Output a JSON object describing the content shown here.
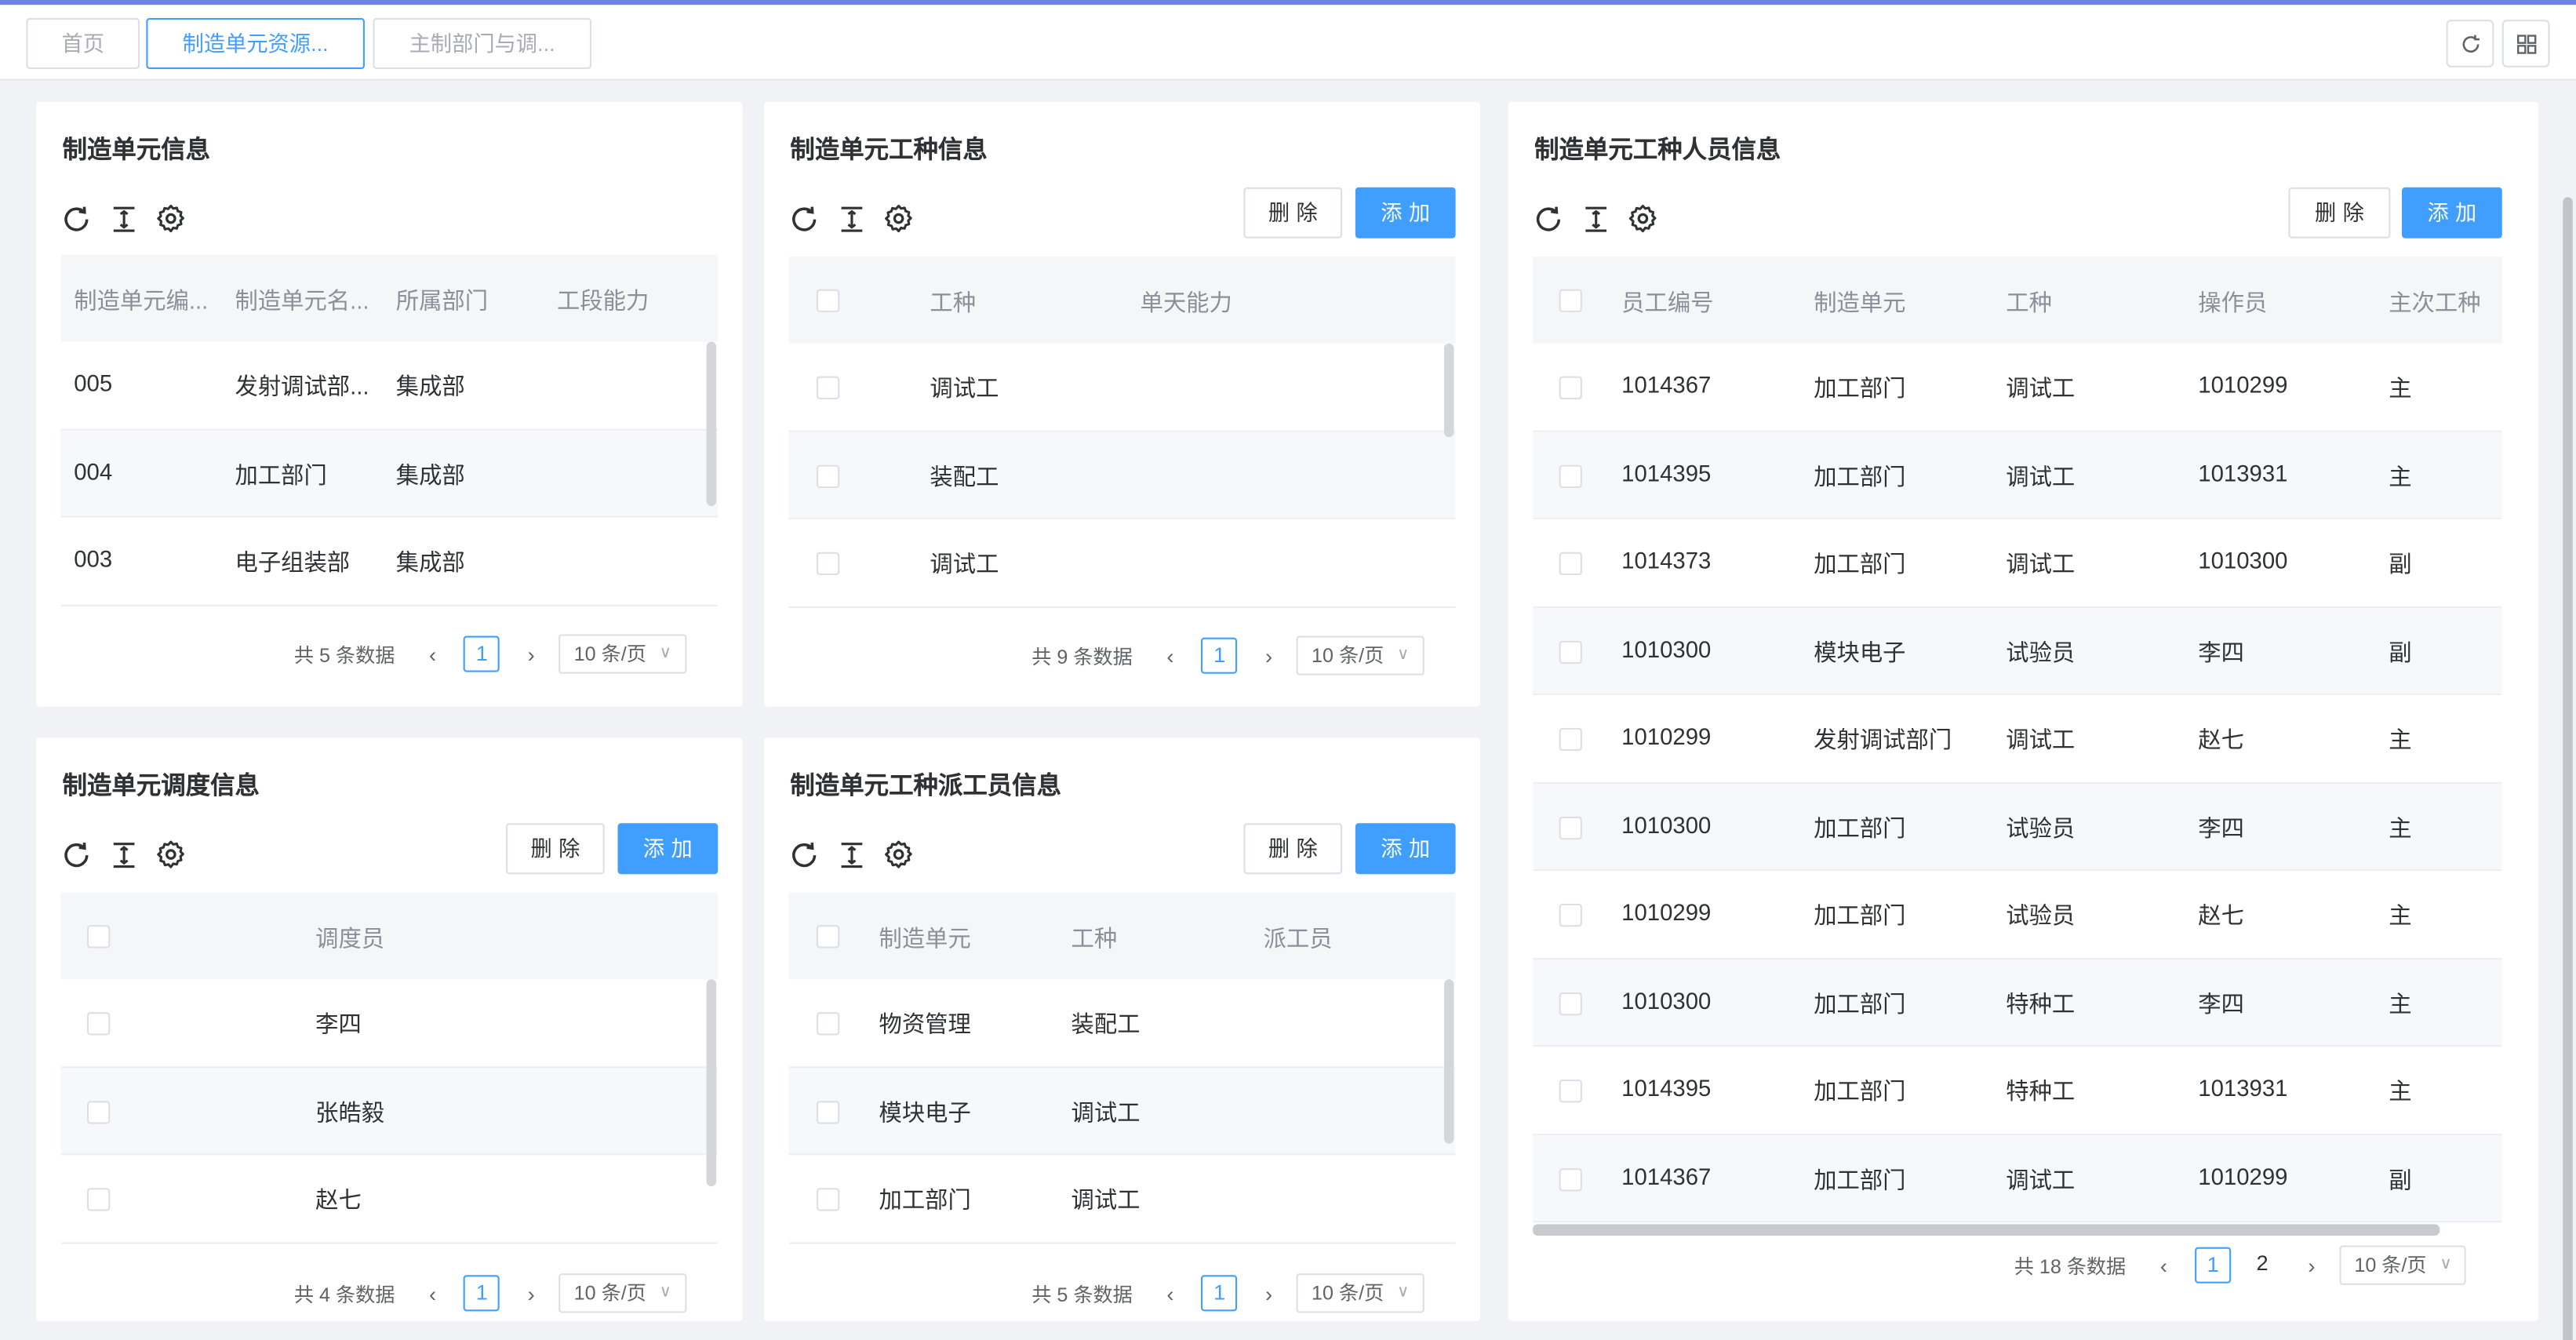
{
  "tabs": [
    "首页",
    "制造单元资源...",
    "主制部门与调..."
  ],
  "panels": {
    "unit_info": {
      "title": "制造单元信息",
      "columns": [
        "制造单元编...",
        "制造单元名...",
        "所属部门",
        "工段能力"
      ],
      "rows": [
        [
          "005",
          "发射调试部...",
          "集成部",
          ""
        ],
        [
          "004",
          "加工部门",
          "集成部",
          ""
        ],
        [
          "003",
          "电子组装部",
          "集成部",
          ""
        ]
      ],
      "total": "共 5 条数据",
      "page": "1",
      "page_size": "10 条/页"
    },
    "unit_jobtype": {
      "title": "制造单元工种信息",
      "delete_label": "删除",
      "add_label": "添加",
      "columns": [
        "工种",
        "单天能力"
      ],
      "rows": [
        [
          "调试工",
          ""
        ],
        [
          "装配工",
          ""
        ],
        [
          "调试工",
          ""
        ]
      ],
      "total": "共 9 条数据",
      "page": "1",
      "page_size": "10 条/页"
    },
    "unit_staff": {
      "title": "制造单元工种人员信息",
      "delete_label": "删除",
      "add_label": "添加",
      "columns": [
        "员工编号",
        "制造单元",
        "工种",
        "操作员",
        "主次工种"
      ],
      "rows": [
        [
          "1014367",
          "加工部门",
          "调试工",
          "1010299",
          "主"
        ],
        [
          "1014395",
          "加工部门",
          "调试工",
          "1013931",
          "主"
        ],
        [
          "1014373",
          "加工部门",
          "调试工",
          "1010300",
          "副"
        ],
        [
          "1010300",
          "模块电子",
          "试验员",
          "李四",
          "副"
        ],
        [
          "1010299",
          "发射调试部门",
          "调试工",
          "赵七",
          "主"
        ],
        [
          "1010300",
          "加工部门",
          "试验员",
          "李四",
          "主"
        ],
        [
          "1010299",
          "加工部门",
          "试验员",
          "赵七",
          "主"
        ],
        [
          "1010300",
          "加工部门",
          "特种工",
          "李四",
          "主"
        ],
        [
          "1014395",
          "加工部门",
          "特种工",
          "1013931",
          "主"
        ],
        [
          "1014367",
          "加工部门",
          "调试工",
          "1010299",
          "副"
        ]
      ],
      "total": "共 18 条数据",
      "page": "1",
      "page2": "2",
      "page_size": "10 条/页"
    },
    "unit_dispatch": {
      "title": "制造单元调度信息",
      "delete_label": "删除",
      "add_label": "添加",
      "columns": [
        "调度员"
      ],
      "rows": [
        [
          "李四"
        ],
        [
          "张皓毅"
        ],
        [
          "赵七"
        ]
      ],
      "total": "共 4 条数据",
      "page": "1",
      "page_size": "10 条/页"
    },
    "unit_assign": {
      "title": "制造单元工种派工员信息",
      "delete_label": "删除",
      "add_label": "添加",
      "columns": [
        "制造单元",
        "工种",
        "派工员"
      ],
      "rows": [
        [
          "物资管理",
          "装配工",
          ""
        ],
        [
          "模块电子",
          "调试工",
          ""
        ],
        [
          "加工部门",
          "调试工",
          ""
        ]
      ],
      "total": "共 5 条数据",
      "page": "1",
      "page_size": "10 条/页"
    }
  },
  "icons": {
    "refresh": "refresh-icon",
    "column_height": "column-height-icon",
    "settings": "gear-icon",
    "fullscreen": "grid-icon",
    "prev": "chevron-left-icon",
    "next": "chevron-right-icon",
    "dropdown": "chevron-down-icon"
  },
  "colors": {
    "primary": "#409eff",
    "topline": "#6f82ea",
    "background": "#f0f2f5"
  }
}
